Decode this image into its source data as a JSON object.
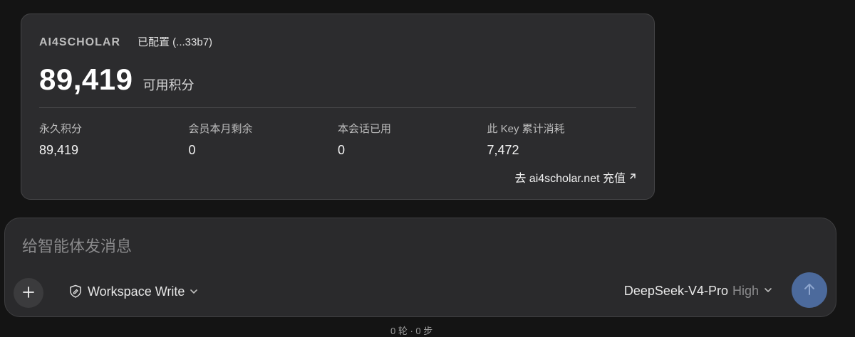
{
  "card": {
    "brand": "AI4SCHOLAR",
    "status": "已配置 (...33b7)",
    "balance_value": "89,419",
    "balance_label": "可用积分",
    "stats": [
      {
        "label": "永久积分",
        "value": "89,419"
      },
      {
        "label": "会员本月剩余",
        "value": "0"
      },
      {
        "label": "本会话已用",
        "value": "0"
      },
      {
        "label": "此 Key 累计消耗",
        "value": "7,472"
      }
    ],
    "recharge_link": "去 ai4scholar.net 充值"
  },
  "composer": {
    "placeholder": "给智能体发消息",
    "mode_label": "Workspace Write",
    "model_name": "DeepSeek-V4-Pro",
    "model_effort": "High"
  },
  "footer": {
    "text": "0 轮 · 0 步"
  },
  "icons": {
    "add": "plus-icon",
    "mode": "shield-edit-icon",
    "chevron": "chevron-down-icon",
    "send": "arrow-up-icon",
    "external": "arrow-up-right-icon"
  },
  "colors": {
    "send_button": "#4c6a9c",
    "card_bg": "#2c2c2e"
  }
}
